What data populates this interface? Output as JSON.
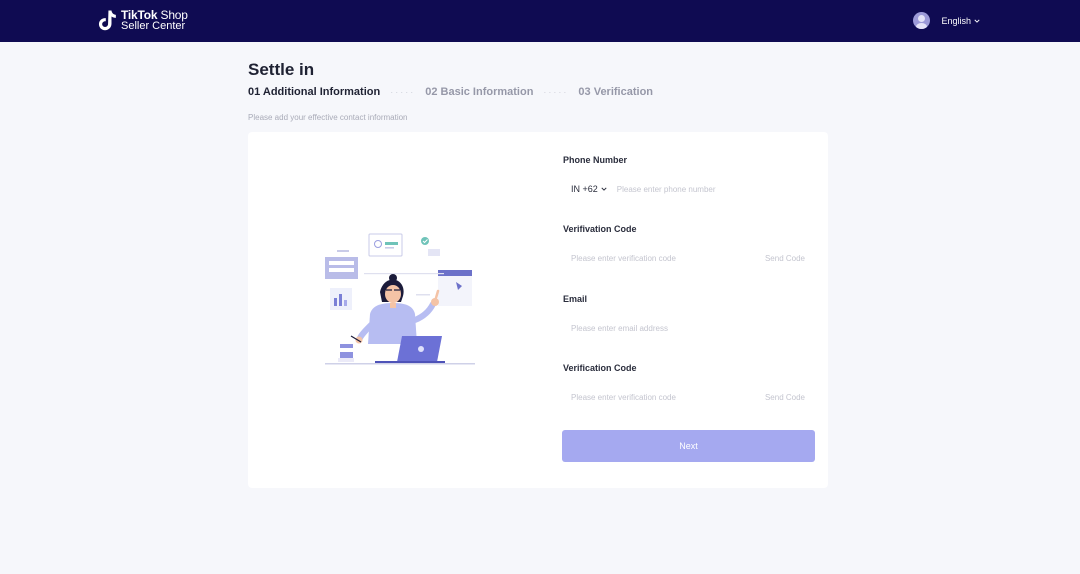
{
  "header": {
    "brand_line1_bold": "TikTok",
    "brand_line1_thin": " Shop",
    "brand_line2": "Seller Center",
    "language": "English"
  },
  "page": {
    "title": "Settle in",
    "subtitle": "Please add your effective contact information"
  },
  "steps": [
    {
      "label": "01 Additional Information",
      "state": "active"
    },
    {
      "label": "02 Basic Information",
      "state": "inactive"
    },
    {
      "label": "03 Verification",
      "state": "inactive"
    }
  ],
  "form": {
    "phone": {
      "label": "Phone Number",
      "country_code": "IN +62",
      "placeholder": "Please enter phone number",
      "value": ""
    },
    "phone_code": {
      "label": "Verifivation Code",
      "placeholder": "Please enter verification code",
      "value": "",
      "send_label": "Send Code"
    },
    "email": {
      "label": "Email",
      "placeholder": "Please enter email address",
      "value": ""
    },
    "email_code": {
      "label": "Verification Code",
      "placeholder": "Please enter verification code",
      "value": "",
      "send_label": "Send Code"
    },
    "next_label": "Next"
  },
  "colors": {
    "header_bg": "#0f0b52",
    "accent": "#a5a9f0",
    "page_bg": "#f6f7fb"
  }
}
